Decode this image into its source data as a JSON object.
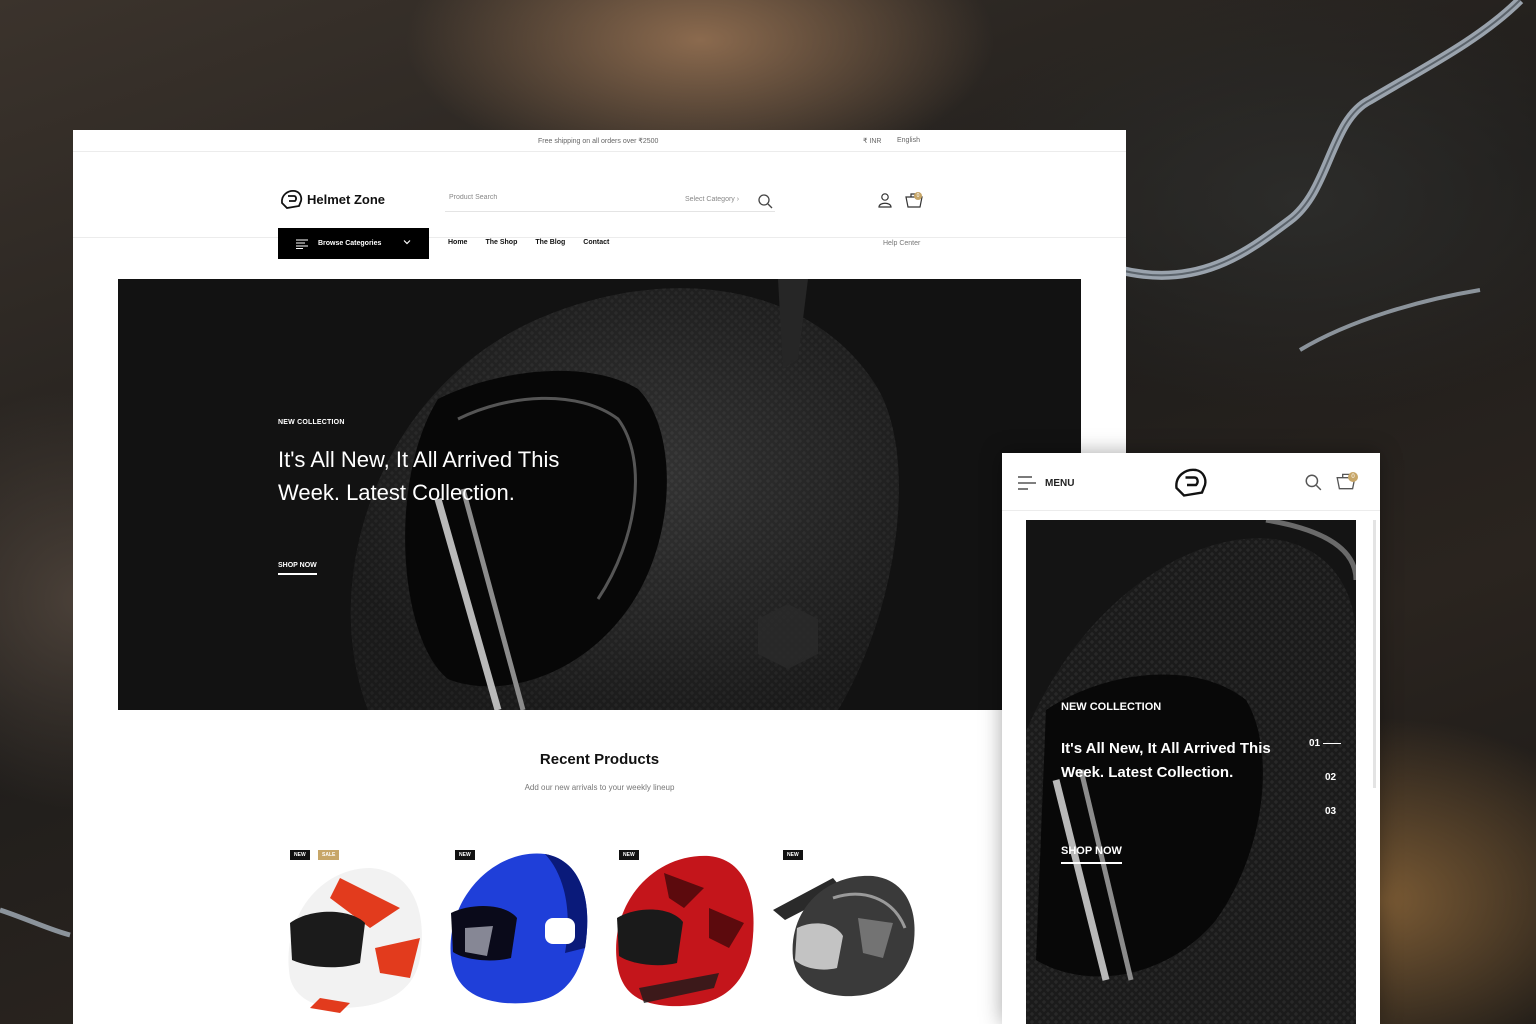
{
  "desktop": {
    "topbar": {
      "shipping": "Free shipping on all orders over ₹2500",
      "currency": "₹ INR",
      "language": "English"
    },
    "header": {
      "logo_text": "Helmet Zone",
      "search_placeholder": "Product Search",
      "select_category": "Select Category",
      "cart_count": "0"
    },
    "nav": {
      "browse_label": "Browse Categories",
      "items": [
        "Home",
        "The Shop",
        "The Blog",
        "Contact"
      ],
      "help": "Help Center"
    },
    "hero": {
      "tag": "NEW COLLECTION",
      "headline": "It's All New, It All Arrived This Week. Latest Collection.",
      "cta": "SHOP NOW"
    },
    "recent": {
      "title": "Recent Products",
      "subtitle": "Add our new arrivals to your weekly lineup",
      "products": [
        {
          "badges": [
            "NEW",
            "SALE"
          ],
          "colors": [
            "#f2f2f2",
            "#e23b1d",
            "#1b1b1b"
          ]
        },
        {
          "badges": [
            "NEW"
          ],
          "colors": [
            "#1f3fd9",
            "#0a1a7a",
            "#ffffff"
          ]
        },
        {
          "badges": [
            "NEW"
          ],
          "colors": [
            "#c4151b",
            "#1a1a1a",
            "#5c0a0d"
          ]
        },
        {
          "badges": [
            "NEW"
          ],
          "colors": [
            "#3a3a3a",
            "#9a9a9a",
            "#1a1a1a"
          ]
        }
      ]
    }
  },
  "mobile": {
    "menu_label": "MENU",
    "cart_count": "0",
    "hero": {
      "tag": "NEW COLLECTION",
      "headline": "It's All New, It All Arrived This Week. Latest Collection.",
      "cta": "SHOP NOW",
      "slides": [
        "01",
        "02",
        "03"
      ]
    }
  },
  "colors": {
    "accent": "#c7a668",
    "dark": "#111111"
  }
}
